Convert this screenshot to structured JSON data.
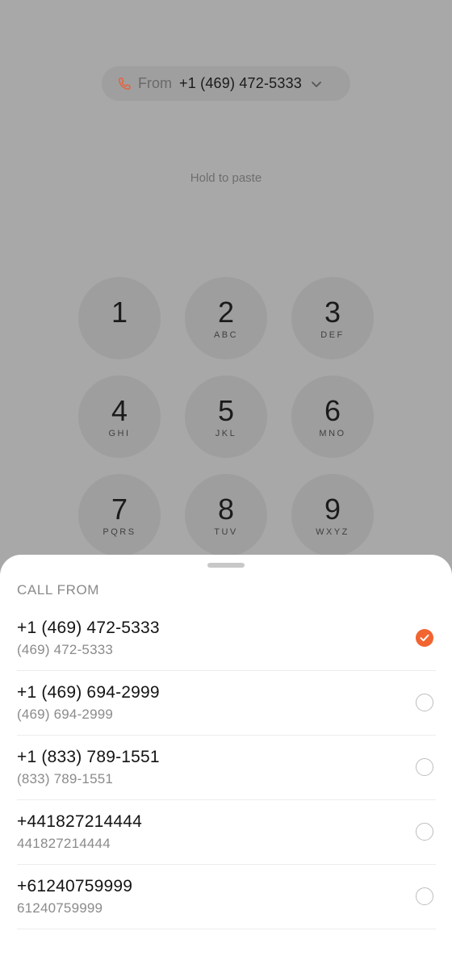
{
  "from_pill": {
    "label": "From",
    "number": "+1 (469) 472-5333",
    "icon": "phone-icon",
    "accent": "#e8603a"
  },
  "hint": "Hold to paste",
  "keypad": [
    {
      "digit": "1",
      "letters": ""
    },
    {
      "digit": "2",
      "letters": "ABC"
    },
    {
      "digit": "3",
      "letters": "DEF"
    },
    {
      "digit": "4",
      "letters": "GHI"
    },
    {
      "digit": "5",
      "letters": "JKL"
    },
    {
      "digit": "6",
      "letters": "MNO"
    },
    {
      "digit": "7",
      "letters": "PQRS"
    },
    {
      "digit": "8",
      "letters": "TUV"
    },
    {
      "digit": "9",
      "letters": "WXYZ"
    }
  ],
  "sheet": {
    "title": "CALL FROM",
    "selected_color": "#f26430",
    "items": [
      {
        "primary": "+1 (469) 472-5333",
        "secondary": "(469) 472-5333",
        "selected": true
      },
      {
        "primary": "+1 (469) 694-2999",
        "secondary": "(469) 694-2999",
        "selected": false
      },
      {
        "primary": "+1 (833) 789-1551",
        "secondary": "(833) 789-1551",
        "selected": false
      },
      {
        "primary": "+441827214444",
        "secondary": "441827214444",
        "selected": false
      },
      {
        "primary": "+61240759999",
        "secondary": "61240759999",
        "selected": false
      }
    ]
  }
}
